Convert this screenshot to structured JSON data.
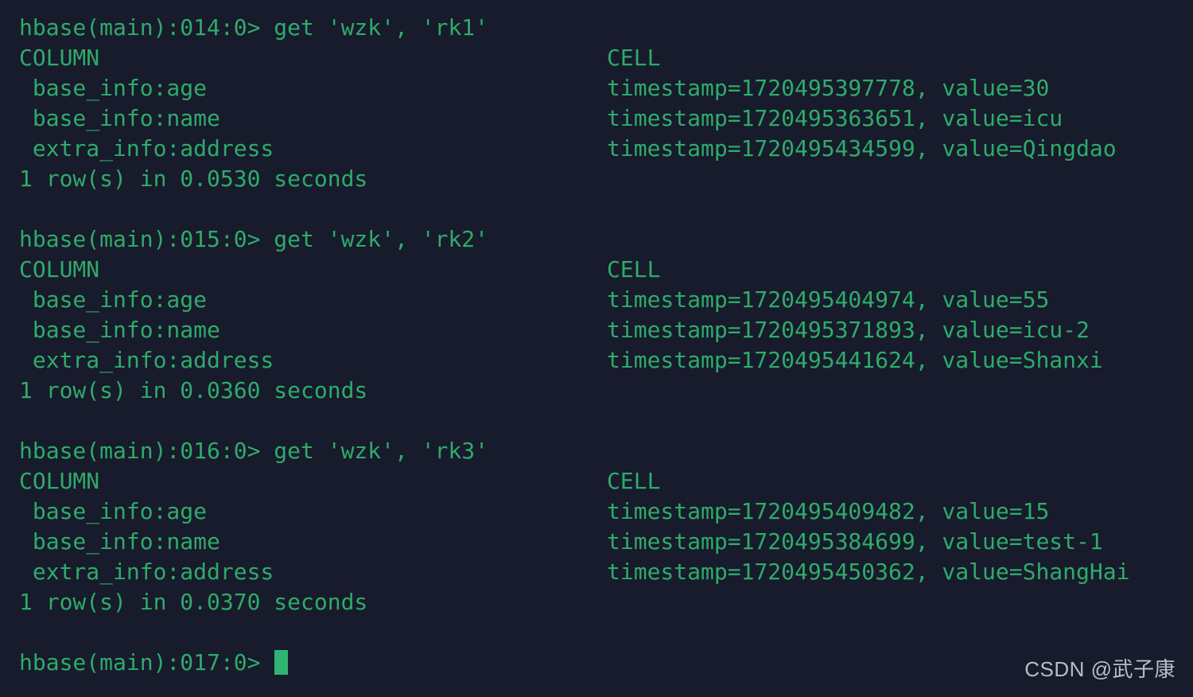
{
  "terminal": {
    "app": "hbase shell",
    "background_color": "#171b2b",
    "text_color": "#2eab6b",
    "cursor_color": "#2fb473",
    "watermark_color": "#b9bdc9",
    "font_size_px": 28,
    "line_height_px": 38
  },
  "watermark": {
    "text": "CSDN @武子康"
  },
  "blocks": [
    {
      "prompt": "hbase(main):014:0> get 'wzk', 'rk1'",
      "header_left": "COLUMN",
      "header_right": "CELL",
      "rows": [
        {
          "column": " base_info:age",
          "cell": "timestamp=1720495397778, value=30"
        },
        {
          "column": " base_info:name",
          "cell": "timestamp=1720495363651, value=icu"
        },
        {
          "column": " extra_info:address",
          "cell": "timestamp=1720495434599, value=Qingdao"
        }
      ],
      "footer": "1 row(s) in 0.0530 seconds"
    },
    {
      "prompt": "hbase(main):015:0> get 'wzk', 'rk2'",
      "header_left": "COLUMN",
      "header_right": "CELL",
      "rows": [
        {
          "column": " base_info:age",
          "cell": "timestamp=1720495404974, value=55"
        },
        {
          "column": " base_info:name",
          "cell": "timestamp=1720495371893, value=icu-2"
        },
        {
          "column": " extra_info:address",
          "cell": "timestamp=1720495441624, value=Shanxi"
        }
      ],
      "footer": "1 row(s) in 0.0360 seconds"
    },
    {
      "prompt": "hbase(main):016:0> get 'wzk', 'rk3'",
      "header_left": "COLUMN",
      "header_right": "CELL",
      "rows": [
        {
          "column": " base_info:age",
          "cell": "timestamp=1720495409482, value=15"
        },
        {
          "column": " base_info:name",
          "cell": "timestamp=1720495384699, value=test-1"
        },
        {
          "column": " extra_info:address",
          "cell": "timestamp=1720495450362, value=ShangHai"
        }
      ],
      "footer": "1 row(s) in 0.0370 seconds"
    }
  ],
  "active_prompt": {
    "text": "hbase(main):017:0> ",
    "input_value": ""
  }
}
